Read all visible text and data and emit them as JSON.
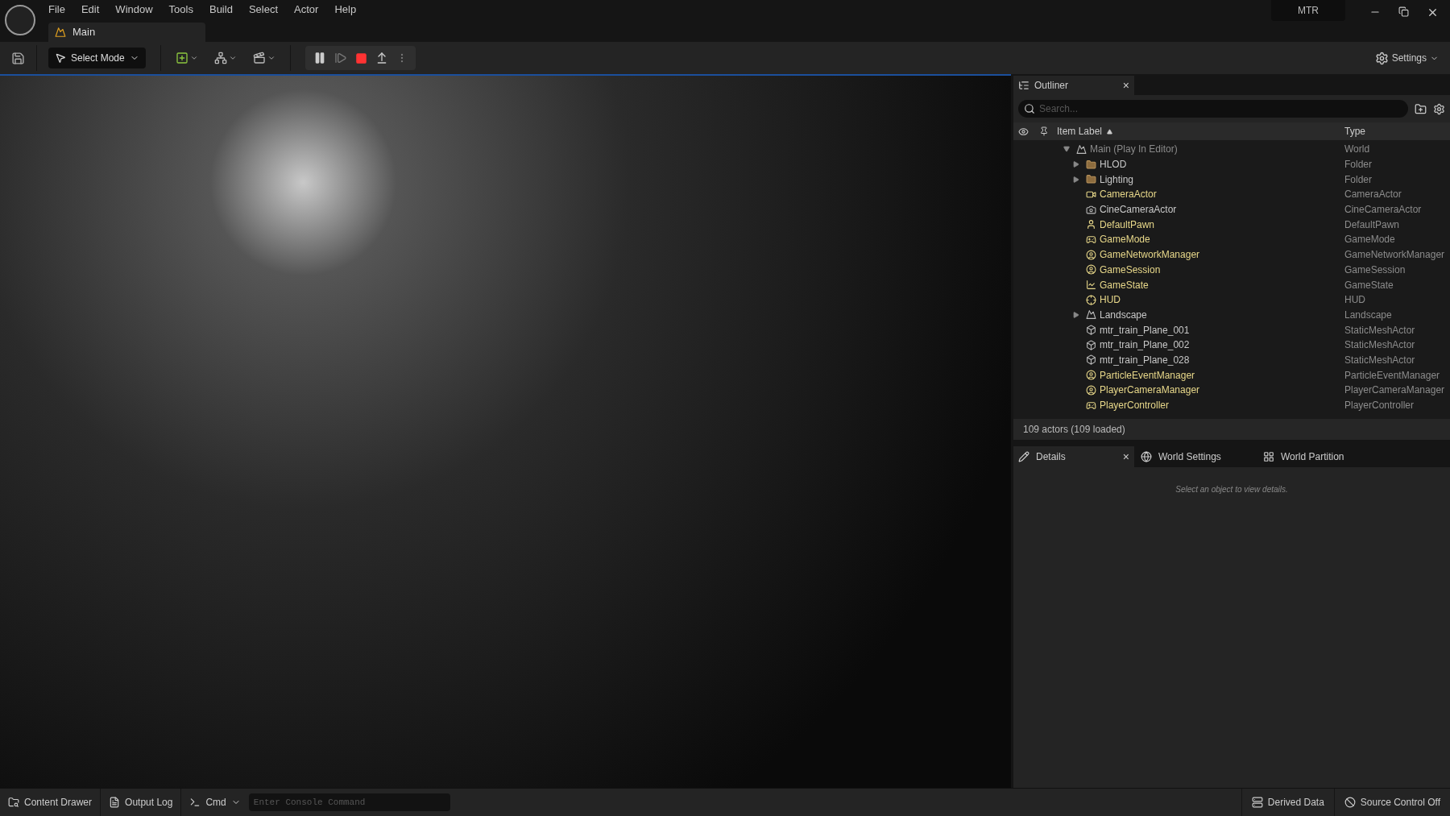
{
  "menu": [
    "File",
    "Edit",
    "Window",
    "Tools",
    "Build",
    "Select",
    "Actor",
    "Help"
  ],
  "level_tab": {
    "label": "Main"
  },
  "project": "MTR",
  "toolbar": {
    "mode": "Select Mode",
    "settings": "Settings"
  },
  "outliner": {
    "tab": "Outliner",
    "close": "×",
    "search": {
      "placeholder": "Search..."
    },
    "columns": [
      "Item Label",
      "Type"
    ],
    "items": [
      {
        "label": "Main (Play In Editor)",
        "type": "World",
        "kind": "world",
        "highlighted": false,
        "expanded": true,
        "children": [
          {
            "label": "HLOD",
            "type": "Folder",
            "kind": "folder",
            "highlighted": false,
            "expanded": false
          },
          {
            "label": "Lighting",
            "type": "Folder",
            "kind": "folder",
            "highlighted": false,
            "expanded": false
          },
          {
            "label": "CameraActor",
            "type": "CameraActor",
            "kind": "camera",
            "highlighted": true
          },
          {
            "label": "CineCameraActor",
            "type": "CineCameraActor",
            "kind": "cine",
            "highlighted": false
          },
          {
            "label": "DefaultPawn",
            "type": "DefaultPawn",
            "kind": "pawn",
            "highlighted": true
          },
          {
            "label": "GameMode",
            "type": "GameMode",
            "kind": "mode",
            "highlighted": true
          },
          {
            "label": "GameNetworkManager",
            "type": "GameNetworkManager",
            "kind": "info",
            "highlighted": true
          },
          {
            "label": "GameSession",
            "type": "GameSession",
            "kind": "info",
            "highlighted": true
          },
          {
            "label": "GameState",
            "type": "GameState",
            "kind": "state",
            "highlighted": true
          },
          {
            "label": "HUD",
            "type": "HUD",
            "kind": "hud",
            "highlighted": true
          },
          {
            "label": "Landscape",
            "type": "Landscape",
            "kind": "landscape",
            "highlighted": false,
            "expanded": false
          },
          {
            "label": "mtr_train_Plane_001",
            "type": "StaticMeshActor",
            "kind": "mesh",
            "highlighted": false
          },
          {
            "label": "mtr_train_Plane_002",
            "type": "StaticMeshActor",
            "kind": "mesh",
            "highlighted": false
          },
          {
            "label": "mtr_train_Plane_028",
            "type": "StaticMeshActor",
            "kind": "mesh",
            "highlighted": false
          },
          {
            "label": "ParticleEventManager",
            "type": "ParticleEventManager",
            "kind": "info",
            "highlighted": true
          },
          {
            "label": "PlayerCameraManager",
            "type": "PlayerCameraManager",
            "kind": "info",
            "highlighted": true
          },
          {
            "label": "PlayerController",
            "type": "PlayerController",
            "kind": "controller",
            "highlighted": true
          }
        ]
      }
    ],
    "status": "109 actors (109 loaded)"
  },
  "details_tabs": [
    {
      "label": "Details",
      "kind": "details",
      "selected": true,
      "close": "×"
    },
    {
      "label": "World Settings",
      "kind": "world",
      "selected": false
    },
    {
      "label": "World Partition",
      "kind": "partition",
      "selected": false
    }
  ],
  "details_empty": "Select an object to view details.",
  "bottom": {
    "content_drawer": "Content Drawer",
    "output_log": "Output Log",
    "cmd": "Cmd",
    "console": {
      "placeholder": "Enter Console Command"
    },
    "derived_data": "Derived Data",
    "source_control": "Source Control Off"
  }
}
